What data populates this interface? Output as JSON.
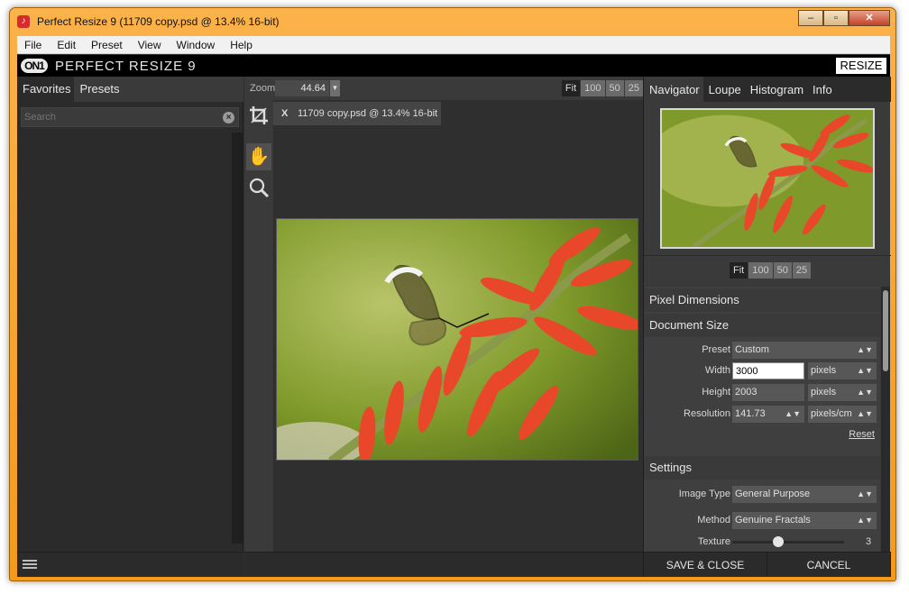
{
  "window": {
    "title": "Perfect Resize 9 (11709 copy.psd @ 13.4% 16-bit)",
    "app_icon": "app-icon",
    "controls": [
      "minimize",
      "maximize",
      "close"
    ]
  },
  "menu": [
    "File",
    "Edit",
    "Preset",
    "View",
    "Window",
    "Help"
  ],
  "brand": {
    "logo_text": "ON1",
    "title": "PERFECT RESIZE 9",
    "resize_button": "RESIZE"
  },
  "left_panel": {
    "tabs": [
      "Favorites",
      "Presets"
    ],
    "search_placeholder": "Search"
  },
  "center": {
    "zoom_label": "Zoom",
    "zoom_value": "44.64",
    "zoom_buttons": [
      "Fit",
      "100",
      "50",
      "25"
    ],
    "doc_tab": {
      "close": "X",
      "name": "11709 copy.psd @ 13.4% 16-bit"
    },
    "tools": [
      "crop-icon",
      "hand-icon",
      "zoom-icon"
    ]
  },
  "right_panel": {
    "tabs": [
      "Navigator",
      "Loupe",
      "Histogram",
      "Info"
    ],
    "nav_buttons": [
      "Fit",
      "100",
      "50",
      "25"
    ],
    "sections": {
      "pixel_dimensions": "Pixel Dimensions",
      "document_size": "Document Size",
      "settings": "Settings"
    },
    "document": {
      "preset_label": "Preset",
      "preset_value": "Custom",
      "width_label": "Width",
      "width_value": "3000",
      "width_unit": "pixels",
      "height_label": "Height",
      "height_value": "2003",
      "height_unit": "pixels",
      "resolution_label": "Resolution",
      "resolution_value": "141.73",
      "resolution_unit": "pixels/cm",
      "reset": "Reset"
    },
    "settings": {
      "image_type_label": "Image Type",
      "image_type_value": "General Purpose",
      "method_label": "Method",
      "method_value": "Genuine Fractals",
      "texture_label": "Texture",
      "texture_value": "3"
    },
    "footer": {
      "save": "SAVE & CLOSE",
      "cancel": "CANCEL"
    }
  },
  "colors": {
    "title_bar": "#f6a633",
    "panel_bg": "#3a3a3a",
    "canvas_bg": "#2f2f2f"
  }
}
